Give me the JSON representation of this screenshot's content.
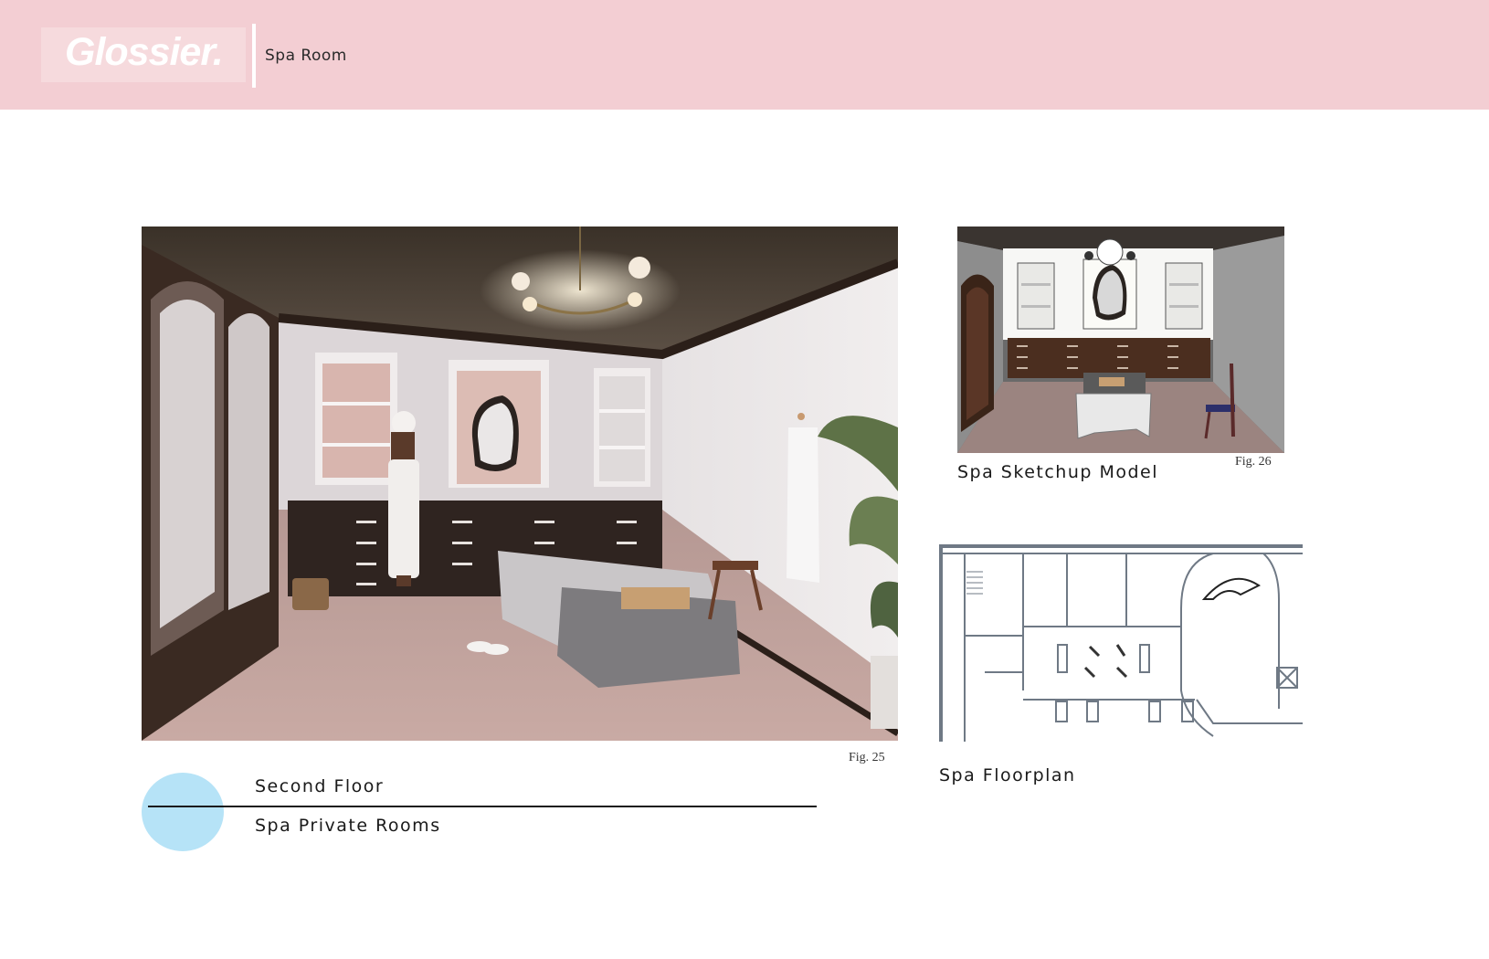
{
  "header": {
    "logo": "Glossier.",
    "section_title": "Spa Room"
  },
  "figures": {
    "main": {
      "fig_label": "Fig. 25"
    },
    "sketch": {
      "fig_label": "Fig. 26",
      "caption": "Spa Sketchup Model"
    },
    "floorplan": {
      "caption": "Spa Floorplan"
    }
  },
  "floor_info": {
    "level": "Second Floor",
    "area": "Spa Private Rooms"
  },
  "colors": {
    "header_bg": "#f3ced3",
    "accent_circle": "#b6e3f7"
  }
}
